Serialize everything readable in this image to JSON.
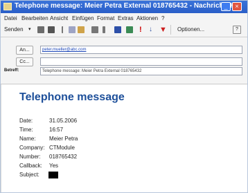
{
  "window": {
    "title": "Telephone message: Meier Petra External 018765432 - Nachricht (H..."
  },
  "menu": [
    "Datei",
    "Bearbeiten",
    "Ansicht",
    "Einfügen",
    "Format",
    "Extras",
    "Aktionen",
    "?"
  ],
  "toolbar": {
    "send_label": "Senden",
    "options_label": "Optionen...",
    "help_label": "?"
  },
  "header": {
    "to_button": "An...",
    "to_value": "peter.mueller@abc.com",
    "cc_button": "Cc...",
    "cc_value": "",
    "subject_label": "Betreff:",
    "subject_value": "Telephone message: Meier Petra External 018765432"
  },
  "message": {
    "title": "Telephone message",
    "fields": [
      {
        "label": "Date:",
        "value": "31.05.2006"
      },
      {
        "label": "Time:",
        "value": "16:57"
      },
      {
        "label": "Name:",
        "value": "Meier Petra"
      },
      {
        "label": "Company:",
        "value": "CTModule"
      },
      {
        "label": "Number:",
        "value": "018765432"
      },
      {
        "label": "Callback:",
        "value": "Yes"
      },
      {
        "label": "Subject:",
        "value": ""
      }
    ]
  },
  "colors": {
    "title_bar": "#2a5ec8",
    "message_title": "#1d4f9a",
    "chrome": "#f4f4f4"
  }
}
